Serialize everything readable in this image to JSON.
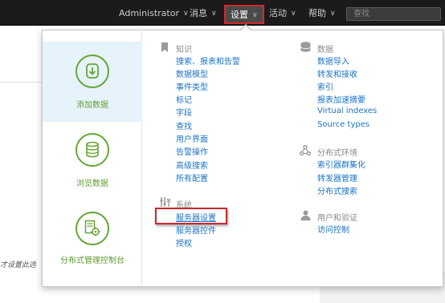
{
  "topbar": {
    "admin": "Administrator",
    "messages": "消息",
    "settings": "设置",
    "activity": "活动",
    "help": "帮助",
    "search_placeholder": "查找"
  },
  "background": {
    "cut_text": "才设置此选"
  },
  "tiles": [
    {
      "label": "添加数据",
      "icon": "add-data-icon",
      "active": true
    },
    {
      "label": "浏览数据",
      "icon": "explore-data-icon",
      "active": false
    },
    {
      "label": "分布式管理控制台",
      "icon": "distributed-console-icon",
      "active": false
    }
  ],
  "knowledge": {
    "heading": "知识",
    "links": [
      "搜索、报表和告警",
      "数据模型",
      "事件类型",
      "标记",
      "字段",
      "查找",
      "用户界面",
      "告警操作",
      "高级搜索",
      "所有配置"
    ]
  },
  "system": {
    "heading": "系统",
    "links": [
      "服务器设置",
      "服务器控件",
      "授权"
    ]
  },
  "data": {
    "heading": "数据",
    "links": [
      "数据导入",
      "转发和接收",
      "索引",
      "报表加速摘要",
      "Virtual indexes",
      "Source types"
    ]
  },
  "distributed": {
    "heading": "分布式环境",
    "links": [
      "索引器群集化",
      "转发器管理",
      "分布式搜索"
    ]
  },
  "users": {
    "heading": "用户和验证",
    "links": [
      "访问控制"
    ]
  },
  "colors": {
    "topbar_bg": "#1b1b1b",
    "highlight_red": "#c8282d",
    "link_blue": "#1a73c8",
    "tile_green": "#65a637",
    "active_tile_bg": "#e7f3fb"
  }
}
